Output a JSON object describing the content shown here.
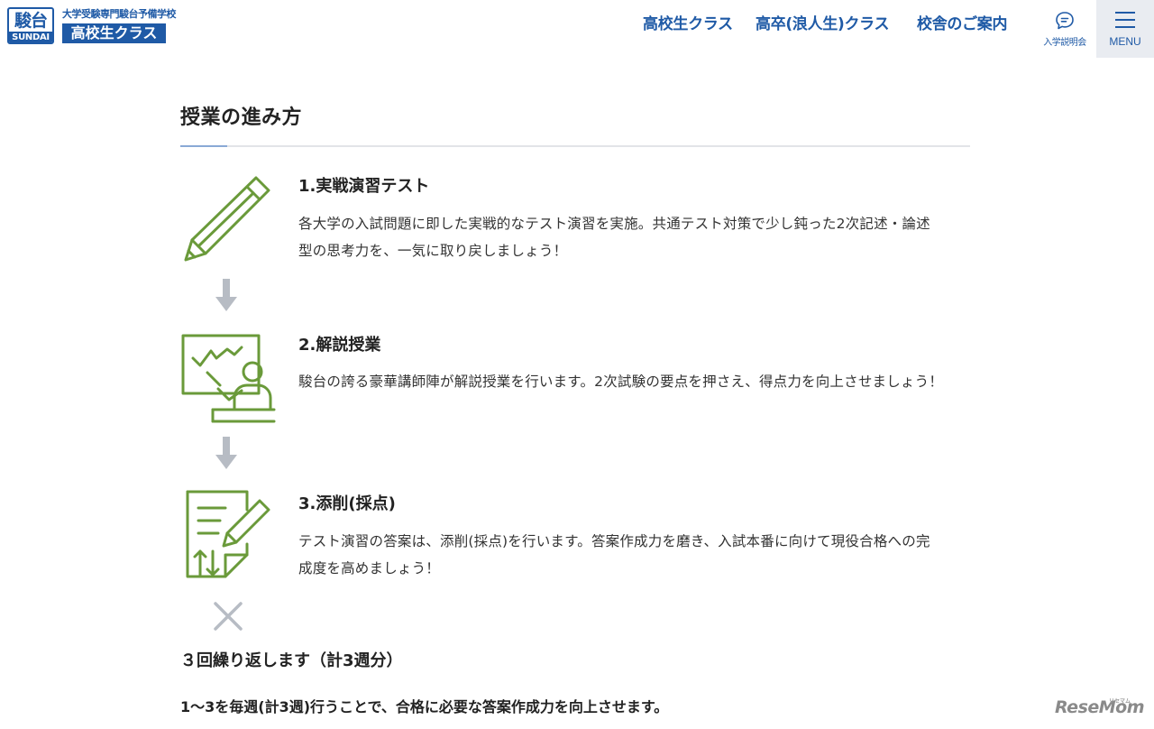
{
  "header": {
    "logo_kanji": "駿台",
    "logo_latin": "SUNDAI",
    "tagline": "大学受験専門駿台予備学校",
    "class_label": "高校生クラス",
    "nav": [
      {
        "label": "高校生クラス"
      },
      {
        "label": "高卒(浪人生)クラス"
      },
      {
        "label": "校舎のご案内"
      }
    ],
    "seminar_label": "入学説明会",
    "seminar_icon": "chat-bubble-icon",
    "menu_label": "MENU",
    "menu_icon": "hamburger-icon"
  },
  "main": {
    "section_title": "授業の進み方",
    "steps": [
      {
        "heading": "1.実戦演習テスト",
        "text_lines": [
          "各大学の入試問題に即した実戦的なテスト演習を実施。共通テスト対策で少し鈍った2次記述・論述",
          "型の思考力を、一気に取り戻しましょう！"
        ],
        "icon": "pencil-icon"
      },
      {
        "heading": "2.解説授業",
        "text_lines": [
          "駿台の誇る豪華講師陣が解説授業を行います。2次試験の要点を押さえ、得点力を向上させましょう！"
        ],
        "icon": "lecture-icon"
      },
      {
        "heading": "3.添削(採点)",
        "text_lines": [
          "テスト演習の答案は、添削(採点)を行います。答案作成力を磨き、入試本番に向けて現役合格への完",
          "成度を高めましょう！"
        ],
        "icon": "grading-document-icon"
      }
    ],
    "repeat_heading": "３回繰り返します（計3週分）",
    "repeat_text": "1～3を毎週(計3週)行うことで、合格に必要な答案作成力を向上させます。"
  },
  "watermark": {
    "text": "ReseMom",
    "kana": "リセマム"
  },
  "colors": {
    "brand_blue": "#1f5aa6",
    "icon_green": "#6a9a3a",
    "arrow_gray": "#b7bcc4",
    "menu_bg": "#e9ecf1"
  }
}
